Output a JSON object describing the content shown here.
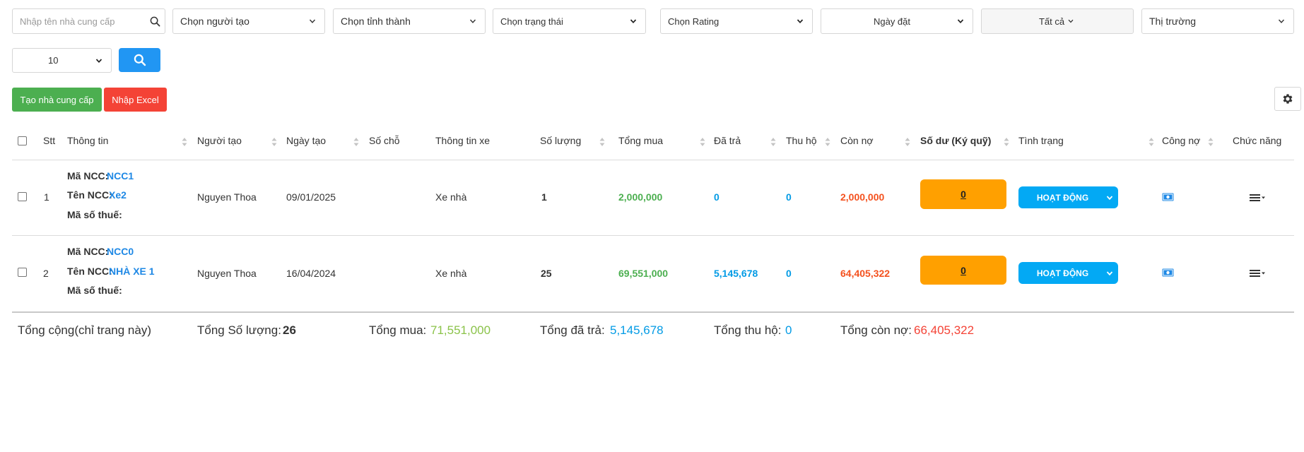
{
  "filters": {
    "search_placeholder": "Nhập tên nhà cung cấp",
    "creator": "Chọn người tạo",
    "province": "Chọn tỉnh thành",
    "status": "Chọn trạng thái",
    "rating": "Chọn Rating",
    "order_date": "Ngày đặt",
    "all": "Tất cả",
    "market": "Thị trường",
    "page_size": "10"
  },
  "actions": {
    "create_label": "Tạo nhà cung cấp",
    "import_label": "Nhập Excel"
  },
  "table": {
    "columns": {
      "stt": "Stt",
      "info": "Thông tin",
      "creator": "Người tạo",
      "created_date": "Ngày tạo",
      "seats": "Số chỗ",
      "vehicle_info": "Thông tin xe",
      "quantity": "Số lượng",
      "total_purchase": "Tổng mua",
      "paid": "Đã trả",
      "collected": "Thu hộ",
      "remaining": "Còn nợ",
      "balance": "Số dư (Ký quỹ)",
      "status": "Tình trạng",
      "debt": "Công nợ",
      "functions": "Chức năng"
    },
    "info_labels": {
      "code": "Mã NCC:",
      "name": "Tên NCC:",
      "tax": "Mã số thuế:"
    },
    "rows": [
      {
        "stt": "1",
        "code": "NCC1",
        "name": "Xe2",
        "tax": "",
        "creator": "Nguyen Thoa",
        "created_date": "09/01/2025",
        "seats": "",
        "vehicle_info": "Xe nhà",
        "quantity": "1",
        "total_purchase": "2,000,000",
        "paid": "0",
        "collected": "0",
        "remaining": "2,000,000",
        "balance": "0",
        "status": "HOẠT ĐỘNG"
      },
      {
        "stt": "2",
        "code": "NCC0",
        "name": "NHÀ XE 1",
        "tax": "",
        "creator": "Nguyen Thoa",
        "created_date": "16/04/2024",
        "seats": "",
        "vehicle_info": "Xe nhà",
        "quantity": "25",
        "total_purchase": "69,551,000",
        "paid": "5,145,678",
        "collected": "0",
        "remaining": "64,405,322",
        "balance": "0",
        "status": "HOẠT ĐỘNG"
      }
    ]
  },
  "totals": {
    "page_label": "Tổng cộng(chỉ trang này)",
    "quantity_label": "Tổng Số lượng:",
    "quantity_value": "26",
    "purchase_label": "Tổng mua:",
    "purchase_value": "71,551,000",
    "paid_label": "Tổng đã trả:",
    "paid_value": "5,145,678",
    "collected_label": "Tổng thu hộ:",
    "collected_value": "0",
    "remaining_label": "Tổng còn nợ:",
    "remaining_value": "66,405,322"
  },
  "icons": {
    "search": "search-icon",
    "chevron": "chevron-down-icon",
    "gear": "gear-icon",
    "sort": "sort-icon",
    "money": "money-icon",
    "menu": "hamburger-menu-icon"
  },
  "colors": {
    "primary": "#2196f3",
    "success": "#4caf50",
    "danger": "#f44336",
    "deposit": "#ffa000",
    "status": "#03a9f4",
    "purchase_text": "#4caf50",
    "paid_text": "#039be5",
    "debt_text": "#f4511e",
    "total_purchase_text": "#8bc34a"
  }
}
